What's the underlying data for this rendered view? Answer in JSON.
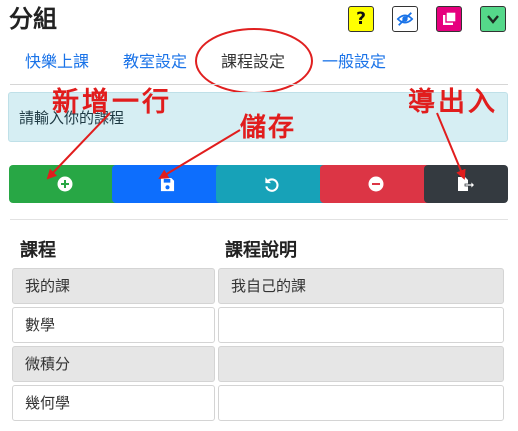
{
  "header": {
    "title": "分組",
    "help_label": "?"
  },
  "toolbar": {
    "help": {
      "icon": "question-icon",
      "color": "#ffff00"
    },
    "visibility": {
      "icon": "eye-slash-icon",
      "color": "#ffffff"
    },
    "copy": {
      "icon": "copy-icon",
      "color": "#e6007e"
    },
    "expand": {
      "icon": "chevron-down-icon",
      "color": "#55d88a"
    }
  },
  "tabs": [
    {
      "label": "快樂上課"
    },
    {
      "label": "教室設定"
    },
    {
      "label": "課程設定",
      "active": true
    },
    {
      "label": "一般設定"
    }
  ],
  "hint": {
    "placeholder": "請輸入你的課程"
  },
  "actions": [
    {
      "name": "add-row",
      "icon": "plus-circle-icon",
      "color": "#28a745"
    },
    {
      "name": "save",
      "icon": "save-icon",
      "color": "#0d6efd"
    },
    {
      "name": "undo",
      "icon": "undo-icon",
      "color": "#17a2b8"
    },
    {
      "name": "delete",
      "icon": "minus-circle-icon",
      "color": "#dc3545"
    },
    {
      "name": "export",
      "icon": "export-icon",
      "color": "#343a40"
    }
  ],
  "annotations": {
    "add_row": "新增一行",
    "save": "儲存",
    "export": "導出入"
  },
  "table": {
    "headers": [
      "課程",
      "課程說明"
    ],
    "rows": [
      [
        "我的課",
        "我自己的課"
      ],
      [
        "數學",
        ""
      ],
      [
        "微積分",
        ""
      ],
      [
        "幾何學",
        ""
      ]
    ]
  }
}
